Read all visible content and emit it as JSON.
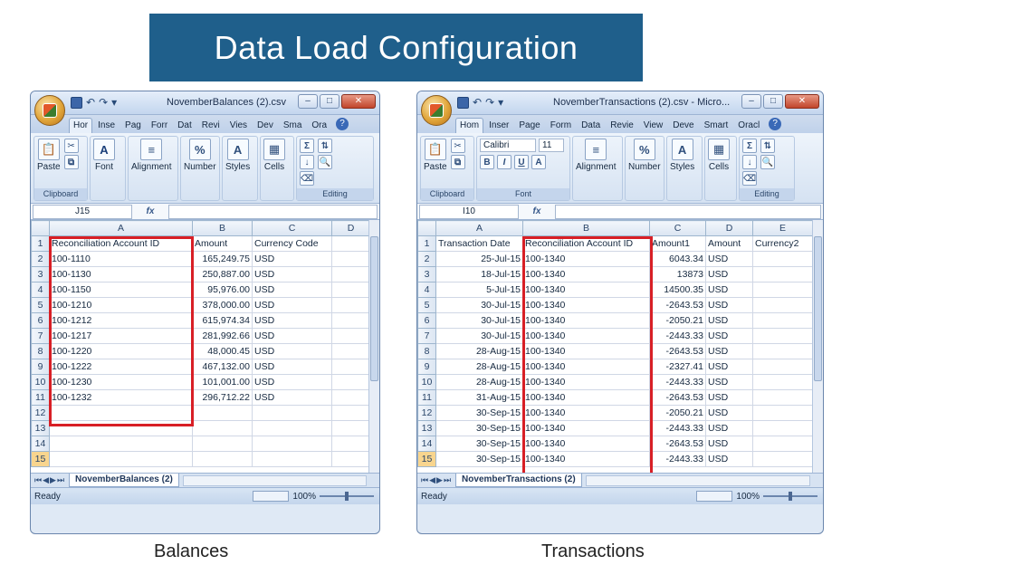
{
  "banner": {
    "title": "Data Load Configuration"
  },
  "captions": {
    "left": "Balances",
    "right": "Transactions"
  },
  "left_window": {
    "title": "NovemberBalances (2).csv",
    "tabs": [
      "Hor",
      "Inse",
      "Pag",
      "Forr",
      "Dat",
      "Revi",
      "Vies",
      "Dev",
      "Sma",
      "Ora"
    ],
    "ribbon": {
      "paste": "Paste",
      "font": "Font",
      "alignment": "Alignment",
      "number": "Number",
      "styles": "Styles",
      "cells": "Cells",
      "clipboard": "Clipboard",
      "editing": "Editing"
    },
    "name_box": "J15",
    "fx": "fx",
    "columns": [
      "A",
      "B",
      "C",
      "D"
    ],
    "rows": [
      [
        "1",
        "Reconciliation Account ID",
        "Amount",
        "Currency Code",
        ""
      ],
      [
        "2",
        "100-1110",
        "165,249.75",
        "USD",
        ""
      ],
      [
        "3",
        "100-1130",
        "250,887.00",
        "USD",
        ""
      ],
      [
        "4",
        "100-1150",
        "95,976.00",
        "USD",
        ""
      ],
      [
        "5",
        "100-1210",
        "378,000.00",
        "USD",
        ""
      ],
      [
        "6",
        "100-1212",
        "615,974.34",
        "USD",
        ""
      ],
      [
        "7",
        "100-1217",
        "281,992.66",
        "USD",
        ""
      ],
      [
        "8",
        "100-1220",
        "48,000.45",
        "USD",
        ""
      ],
      [
        "9",
        "100-1222",
        "467,132.00",
        "USD",
        ""
      ],
      [
        "10",
        "100-1230",
        "101,001.00",
        "USD",
        ""
      ],
      [
        "11",
        "100-1232",
        "296,712.22",
        "USD",
        ""
      ],
      [
        "12",
        "",
        "",
        "",
        ""
      ],
      [
        "13",
        "",
        "",
        "",
        ""
      ],
      [
        "14",
        "",
        "",
        "",
        ""
      ],
      [
        "15",
        "",
        "",
        "",
        ""
      ]
    ],
    "sheet_tab": "NovemberBalances (2)",
    "status": "Ready",
    "zoom": "100%"
  },
  "right_window": {
    "title": "NovemberTransactions (2).csv - Micro...",
    "tabs": [
      "Hom",
      "Inser",
      "Page",
      "Form",
      "Data",
      "Revie",
      "View",
      "Deve",
      "Smart",
      "Oracl"
    ],
    "ribbon": {
      "paste": "Paste",
      "font_name": "Calibri",
      "font_size": "11",
      "font": "Font",
      "alignment": "Alignment",
      "number": "Number",
      "styles": "Styles",
      "cells": "Cells",
      "clipboard": "Clipboard",
      "editing": "Editing"
    },
    "name_box": "I10",
    "fx": "fx",
    "columns": [
      "A",
      "B",
      "C",
      "D",
      "E"
    ],
    "rows": [
      [
        "1",
        "Transaction Date",
        "Reconciliation Account ID",
        "Amount1",
        "Amount",
        "Currency2"
      ],
      [
        "2",
        "25-Jul-15",
        "100-1340",
        "6043.34",
        "USD",
        ""
      ],
      [
        "3",
        "18-Jul-15",
        "100-1340",
        "13873",
        "USD",
        ""
      ],
      [
        "4",
        "5-Jul-15",
        "100-1340",
        "14500.35",
        "USD",
        ""
      ],
      [
        "5",
        "30-Jul-15",
        "100-1340",
        "-2643.53",
        "USD",
        ""
      ],
      [
        "6",
        "30-Jul-15",
        "100-1340",
        "-2050.21",
        "USD",
        ""
      ],
      [
        "7",
        "30-Jul-15",
        "100-1340",
        "-2443.33",
        "USD",
        ""
      ],
      [
        "8",
        "28-Aug-15",
        "100-1340",
        "-2643.53",
        "USD",
        ""
      ],
      [
        "9",
        "28-Aug-15",
        "100-1340",
        "-2327.41",
        "USD",
        ""
      ],
      [
        "10",
        "28-Aug-15",
        "100-1340",
        "-2443.33",
        "USD",
        ""
      ],
      [
        "11",
        "31-Aug-15",
        "100-1340",
        "-2643.53",
        "USD",
        ""
      ],
      [
        "12",
        "30-Sep-15",
        "100-1340",
        "-2050.21",
        "USD",
        ""
      ],
      [
        "13",
        "30-Sep-15",
        "100-1340",
        "-2443.33",
        "USD",
        ""
      ],
      [
        "14",
        "30-Sep-15",
        "100-1340",
        "-2643.53",
        "USD",
        ""
      ],
      [
        "15",
        "30-Sep-15",
        "100-1340",
        "-2443.33",
        "USD",
        ""
      ]
    ],
    "sheet_tab": "NovemberTransactions (2)",
    "status": "Ready",
    "zoom": "100%"
  },
  "colors": {
    "banner": "#1f5f8b",
    "highlight_box": "#d81f26"
  }
}
